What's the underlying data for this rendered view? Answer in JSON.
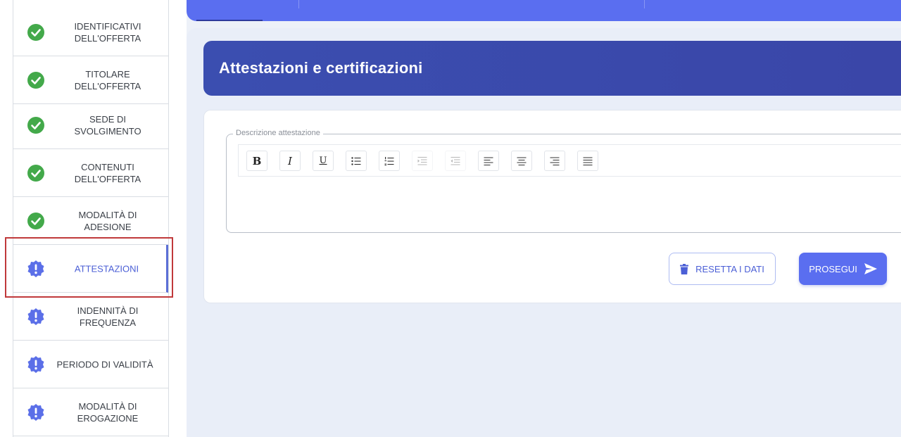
{
  "sidebar": {
    "steps": [
      {
        "label": "IDENTIFICATIVI\nDELL'OFFERTA",
        "status": "done"
      },
      {
        "label": "TITOLARE\nDELL'OFFERTA",
        "status": "done"
      },
      {
        "label": "SEDE DI\nSVOLGIMENTO",
        "status": "done"
      },
      {
        "label": "CONTENUTI\nDELL'OFFERTA",
        "status": "done"
      },
      {
        "label": "MODALITÀ DI\nADESIONE",
        "status": "done"
      },
      {
        "label": "ATTESTAZIONI",
        "status": "pending"
      },
      {
        "label": "INDENNITÀ DI\nFREQUENZA",
        "status": "pending"
      },
      {
        "label": "PERIODO DI VALIDITÀ",
        "status": "pending"
      },
      {
        "label": "MODALITÀ DI\nEROGAZIONE",
        "status": "pending"
      }
    ]
  },
  "section": {
    "title": "Attestazioni e certificazioni"
  },
  "editor": {
    "legend": "Descrizione attestazione",
    "toolbar": [
      {
        "icon": "bold-icon",
        "glyph": "B"
      },
      {
        "icon": "italic-icon",
        "glyph": "I"
      },
      {
        "icon": "underline-icon",
        "glyph": "U"
      },
      {
        "icon": "bullet-list-icon"
      },
      {
        "icon": "numbered-list-icon"
      },
      {
        "icon": "indent-icon"
      },
      {
        "icon": "outdent-icon"
      },
      {
        "icon": "align-left-icon"
      },
      {
        "icon": "align-center-icon"
      },
      {
        "icon": "align-right-icon"
      },
      {
        "icon": "align-justify-icon"
      }
    ]
  },
  "actions": {
    "reset_label": "RESETTA I DATI",
    "next_label": "PROSEGUI"
  },
  "colors": {
    "accent": "#5a6ef0",
    "header": "#3b4eb0",
    "done": "#43a94a",
    "pending": "#5b6fe8",
    "highlight": "#c0393b"
  }
}
